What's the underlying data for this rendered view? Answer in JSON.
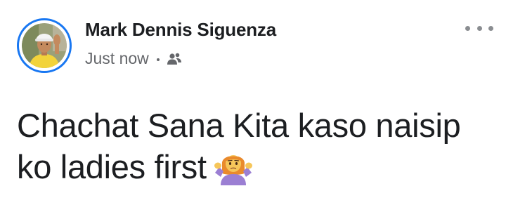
{
  "post": {
    "author": "Mark Dennis Siguenza",
    "timestamp": "Just now",
    "audience_icon": "friends-icon",
    "more_icon": "more-horizontal-icon",
    "body_line1": "Chachat Sana Kita kaso naisip",
    "body_line2": "ko ladies first",
    "emoji": "person-shrugging-emoji",
    "accent_color": "#1877f2"
  }
}
